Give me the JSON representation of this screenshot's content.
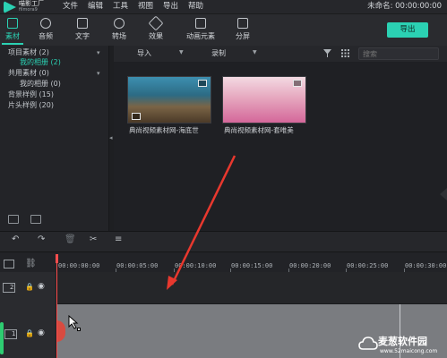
{
  "app": {
    "name": "喵影工厂",
    "sub": "filmora9",
    "project_title": "未命名: 00:00:00:00"
  },
  "menu": [
    "文件",
    "编辑",
    "工具",
    "视图",
    "导出",
    "帮助"
  ],
  "tabs": [
    {
      "label": "素材",
      "icon": "media-icon",
      "active": true
    },
    {
      "label": "音频",
      "icon": "music-icon"
    },
    {
      "label": "文字",
      "icon": "text-icon"
    },
    {
      "label": "转场",
      "icon": "transition-icon"
    },
    {
      "label": "效果",
      "icon": "effects-icon"
    },
    {
      "label": "动画元素",
      "icon": "elements-icon"
    },
    {
      "label": "分屏",
      "icon": "split-screen-icon"
    }
  ],
  "export_label": "导出",
  "library": {
    "items": [
      {
        "label": "项目素材 (2)",
        "chevron": true
      },
      {
        "label": "我的相册 (2)",
        "active": true
      },
      {
        "label": "共用素材 (0)",
        "chevron": true
      },
      {
        "label": "我的相册 (0)"
      },
      {
        "label": "背景样例 (15)"
      },
      {
        "label": "片头样例 (20)"
      }
    ]
  },
  "media_toolbar": {
    "import_label": "导入",
    "record_label": "录制",
    "search_placeholder": "搜索"
  },
  "media_items": [
    {
      "label": "典尚视频素材网-海底世",
      "color_top": "#2f7fa0",
      "color_bottom": "#6b5a3e"
    },
    {
      "label": "典尚视频素材网-套唯美",
      "color_top": "#e9b8c7",
      "color_bottom": "#d86a9a"
    }
  ],
  "timeline": {
    "tools": [
      "undo-icon",
      "redo-icon",
      "delete-icon",
      "cut-icon",
      "adjust-icon"
    ],
    "ruler_labels": [
      "00:00:00:00",
      "00:00:05:00",
      "00:00:10:00",
      "00:00:15:00",
      "00:00:20:00",
      "00:00:25:00",
      "00:00:30:00"
    ],
    "tracks": [
      {
        "label": "2"
      },
      {
        "label": "1"
      }
    ]
  },
  "watermark": {
    "text": "麦葱软件园",
    "url": "www.52maicong.com"
  },
  "colors": {
    "accent": "#2bd1b3",
    "playhead": "#ff4d4d",
    "background": "#1e1f22"
  }
}
